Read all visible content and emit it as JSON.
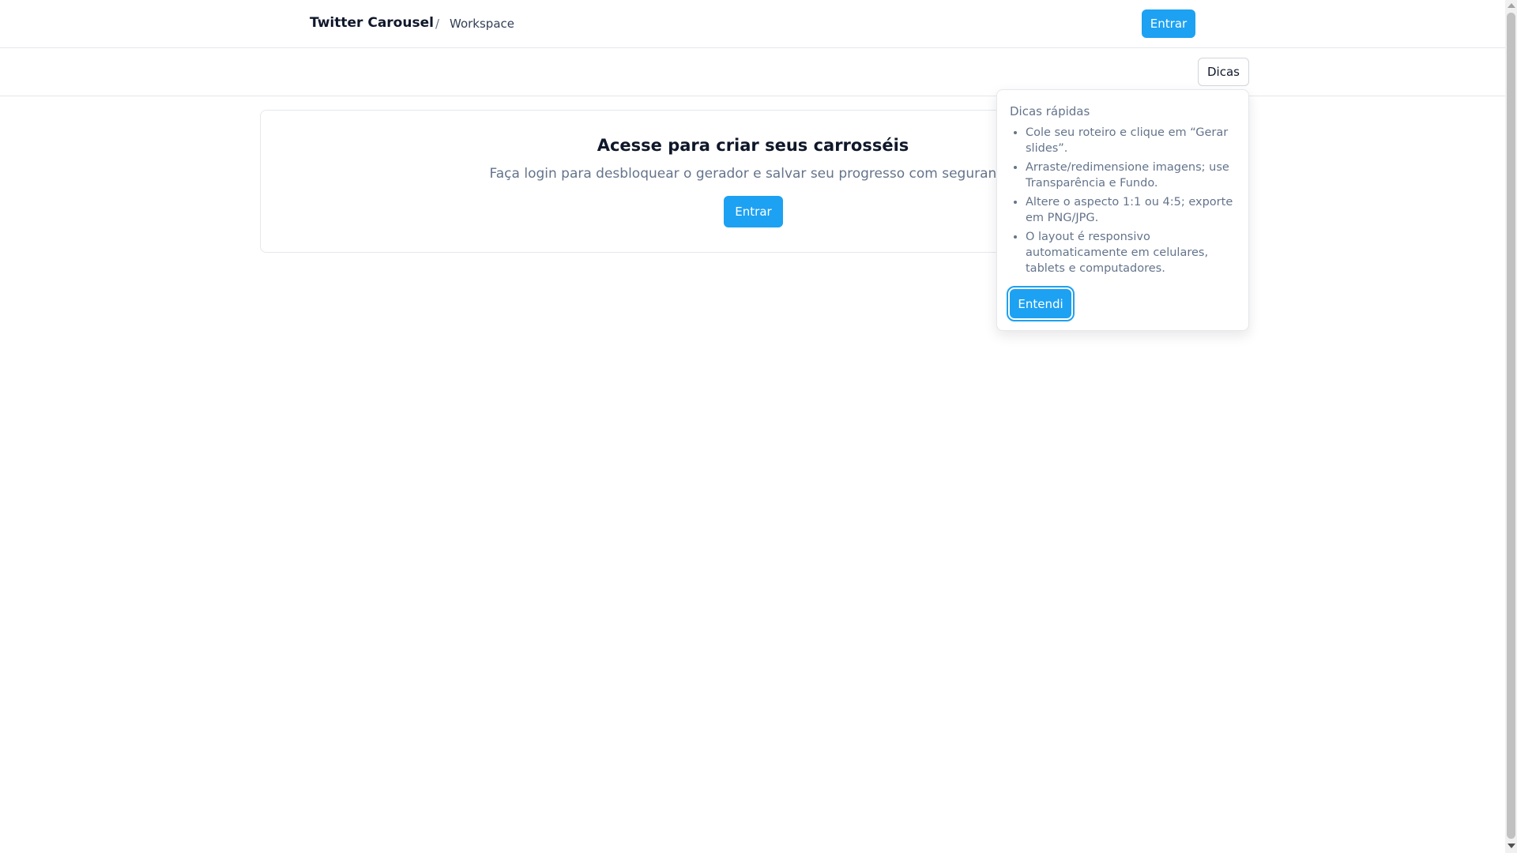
{
  "header": {
    "brand": "Twitter Carousel",
    "separator": "/",
    "breadcrumb": "Workspace",
    "login_label": "Entrar"
  },
  "toolbar": {
    "tips_label": "Dicas"
  },
  "main": {
    "title": "Acesse para criar seus carrosséis",
    "subtitle": "Faça login para desbloquear o gerador e salvar seu progresso com segurança.",
    "login_label": "Entrar"
  },
  "tips_popover": {
    "title": "Dicas rápidas",
    "items": [
      "Cole seu roteiro e clique em “Gerar slides”.",
      "Arraste/redimensione imagens; use Transparência e Fundo.",
      "Altere o aspecto 1:1 ou 4:5; exporte em PNG/JPG.",
      "O layout é responsivo automaticamente em celulares, tablets e computadores."
    ],
    "confirm_label": "Entendi"
  },
  "colors": {
    "accent": "#1da1f2",
    "text_primary": "#0f172a",
    "text_muted": "#64748b",
    "border": "#e5e7eb"
  }
}
